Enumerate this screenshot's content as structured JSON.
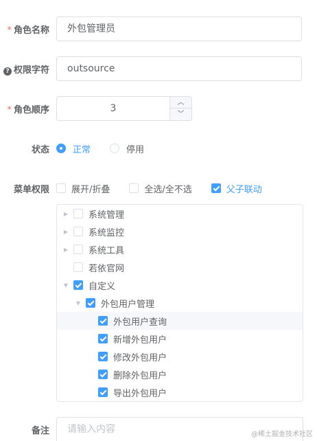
{
  "form": {
    "role_name": {
      "label": "角色名称",
      "value": "外包管理员"
    },
    "permission_key": {
      "label": "权限字符",
      "value": "outsource"
    },
    "role_order": {
      "label": "角色顺序",
      "value": "3"
    },
    "status": {
      "label": "状态",
      "options": [
        "正常",
        "停用"
      ],
      "selected": "正常"
    },
    "menu_permission": {
      "label": "菜单权限",
      "toggles": [
        {
          "label": "展开/折叠",
          "checked": false
        },
        {
          "label": "全选/全不选",
          "checked": false
        },
        {
          "label": "父子联动",
          "checked": true
        }
      ]
    },
    "remark": {
      "label": "备注",
      "placeholder": "请输入内容"
    }
  },
  "tree": [
    {
      "label": "系统管理",
      "checked": false
    },
    {
      "label": "系统监控",
      "checked": false
    },
    {
      "label": "系统工具",
      "checked": false
    },
    {
      "label": "若依官网",
      "checked": false
    },
    {
      "label": "自定义",
      "checked": true
    },
    {
      "label": "外包用户管理",
      "checked": true
    },
    {
      "label": "外包用户查询",
      "checked": true
    },
    {
      "label": "新增外包用户",
      "checked": true
    },
    {
      "label": "修改外包用户",
      "checked": true
    },
    {
      "label": "删除外包用户",
      "checked": true
    },
    {
      "label": "导出外包用户",
      "checked": true
    }
  ],
  "watermark": "@稀土掘金技术社区",
  "colors": {
    "primary": "#409eff",
    "required": "#f56c6c"
  }
}
